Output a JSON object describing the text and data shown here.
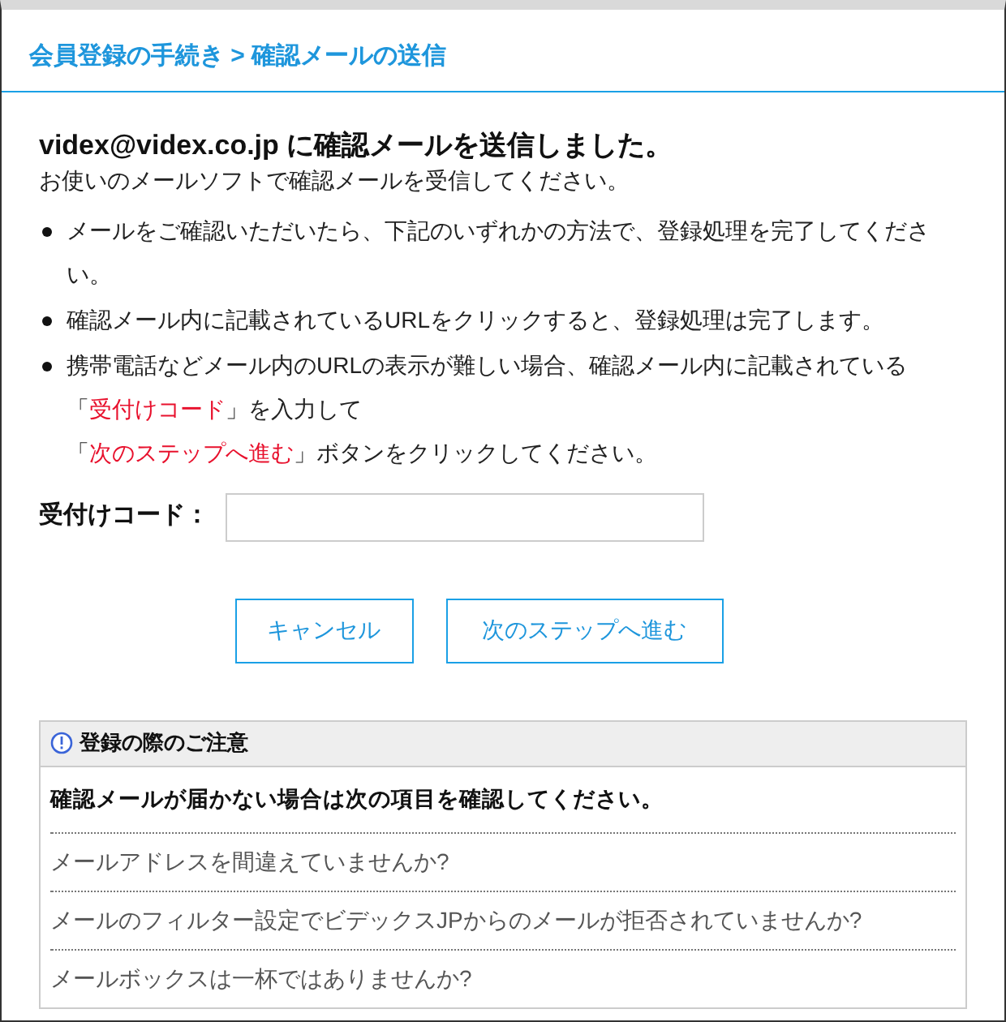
{
  "page_title": "会員登録の手続き > 確認メールの送信",
  "heading": "videx@videx.co.jp に確認メールを送信しました。",
  "subheading": "お使いのメールソフトで確認メールを受信してください。",
  "instructions": [
    {
      "lines": [
        [
          {
            "text": "メールをご確認いただいたら、下記のいずれかの方法で、登録処理を完了してください。",
            "highlight": false
          }
        ]
      ]
    },
    {
      "lines": [
        [
          {
            "text": "確認メール内に記載されているURLをクリックすると、登録処理は完了します。",
            "highlight": false
          }
        ]
      ]
    },
    {
      "lines": [
        [
          {
            "text": "携帯電話などメール内のURLの表示が難しい場合、確認メール内に記載されている",
            "highlight": false
          }
        ],
        [
          {
            "text": "「",
            "highlight": false
          },
          {
            "text": "受付けコード",
            "highlight": true
          },
          {
            "text": "」を入力して",
            "highlight": false
          }
        ],
        [
          {
            "text": "「",
            "highlight": false
          },
          {
            "text": "次のステップへ進む",
            "highlight": true
          },
          {
            "text": "」ボタンをクリックしてください。",
            "highlight": false
          }
        ]
      ]
    }
  ],
  "code_field": {
    "label": "受付けコード："
  },
  "buttons": [
    "キャンセル",
    "次のステップへ進む"
  ],
  "notice": {
    "title": "登録の際のご注意",
    "lead": "確認メールが届かない場合は次の項目を確認してください。",
    "items": [
      "メールアドレスを間違えていませんか?",
      "メールのフィルター設定でビデックスJPからのメールが拒否されていませんか?",
      "メールボックスは一杯ではありませんか?"
    ]
  }
}
